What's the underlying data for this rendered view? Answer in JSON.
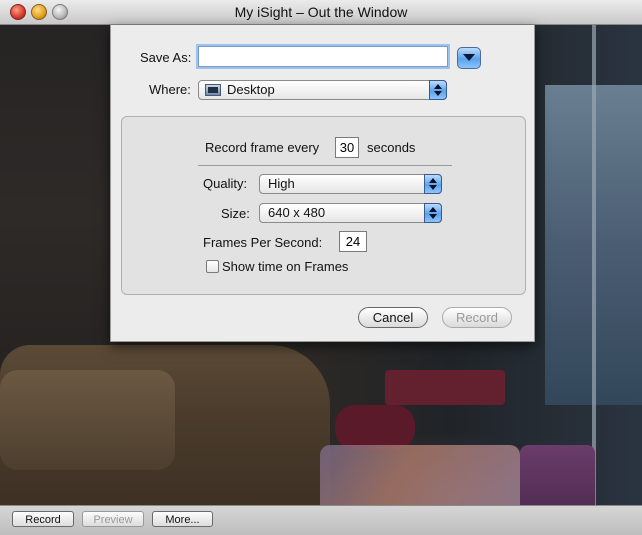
{
  "window": {
    "title": "My iSight – Out the Window"
  },
  "sheet": {
    "save_as_label": "Save As:",
    "save_as_value": "",
    "where_label": "Where:",
    "where_value": "Desktop",
    "record_every_label": "Record frame every",
    "record_every_value": "30",
    "seconds_label": "seconds",
    "quality_label": "Quality:",
    "quality_value": "High",
    "size_label": "Size:",
    "size_value": "640 x 480",
    "fps_label": "Frames Per Second:",
    "fps_value": "24",
    "show_time_label": "Show time on Frames",
    "show_time_checked": false,
    "cancel_label": "Cancel",
    "record_label": "Record"
  },
  "bottom_bar": {
    "record_label": "Record",
    "preview_label": "Preview",
    "more_label": "More..."
  },
  "colors": {
    "accent_blue": "#5da2ea",
    "focus_ring": "#9cc2ef"
  },
  "icons": {
    "where_icon": "desktop-folder-icon",
    "disclosure": "chevron-down-icon"
  }
}
